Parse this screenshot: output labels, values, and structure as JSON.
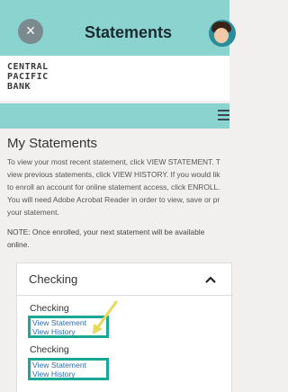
{
  "topbar": {
    "title": "Statements",
    "close_glyph": "×"
  },
  "brand": {
    "logo_lines": [
      "CENTRAL",
      "PACIFIC",
      "BANK"
    ]
  },
  "page": {
    "title": "My Statements",
    "intro_lines": [
      "To view your most recent statement, click VIEW STATEMENT. T",
      "view previous statements, click VIEW HISTORY. If you would lik",
      "to enroll an account for online statement access, click ENROLL.",
      "You will need Adobe Acrobat Reader in order to view, save or pr",
      "your statement."
    ],
    "note_lines": [
      "NOTE: Once enrolled, your next statement will be available",
      "online."
    ]
  },
  "accordion": {
    "title": "Checking",
    "groups": [
      {
        "title": "Checking",
        "view_statement": "View Statement",
        "view_history": "View History"
      },
      {
        "title": "Checking",
        "view_statement": "View Statement",
        "view_history": "View History"
      }
    ]
  },
  "colors": {
    "header": "#8ad3ce",
    "highlight": "#1aa896",
    "arrow": "#e8d95a",
    "link": "#2c6fb5"
  },
  "icons": {
    "close": "close-icon",
    "menu": "hamburger-menu-icon",
    "collapse": "chevron-up-icon",
    "avatar": "avatar-icon",
    "annotation": "yellow-arrow-annotation"
  }
}
